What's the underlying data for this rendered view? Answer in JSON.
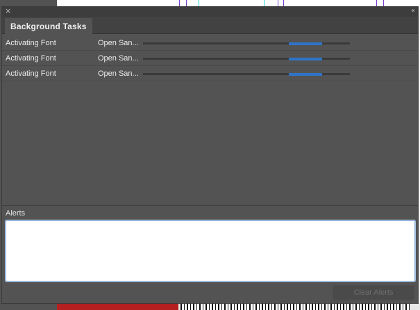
{
  "panel": {
    "close_glyph": "×",
    "collapse_glyph": "‹‹",
    "tab_title": "Background Tasks"
  },
  "tasks": [
    {
      "name": "Activating Font",
      "detail": "Open San...",
      "progress": 0.7
    },
    {
      "name": "Activating Font",
      "detail": "Open San...",
      "progress": 0.7
    },
    {
      "name": "Activating Font",
      "detail": "Open San...",
      "progress": 0.7
    }
  ],
  "alerts": {
    "label": "Alerts",
    "text": "",
    "clear_button": "Clear Alerts"
  },
  "colors": {
    "panel_bg": "#535353",
    "progress_fill": "#2f74c8",
    "alerts_focus": "#8fb0d6"
  }
}
